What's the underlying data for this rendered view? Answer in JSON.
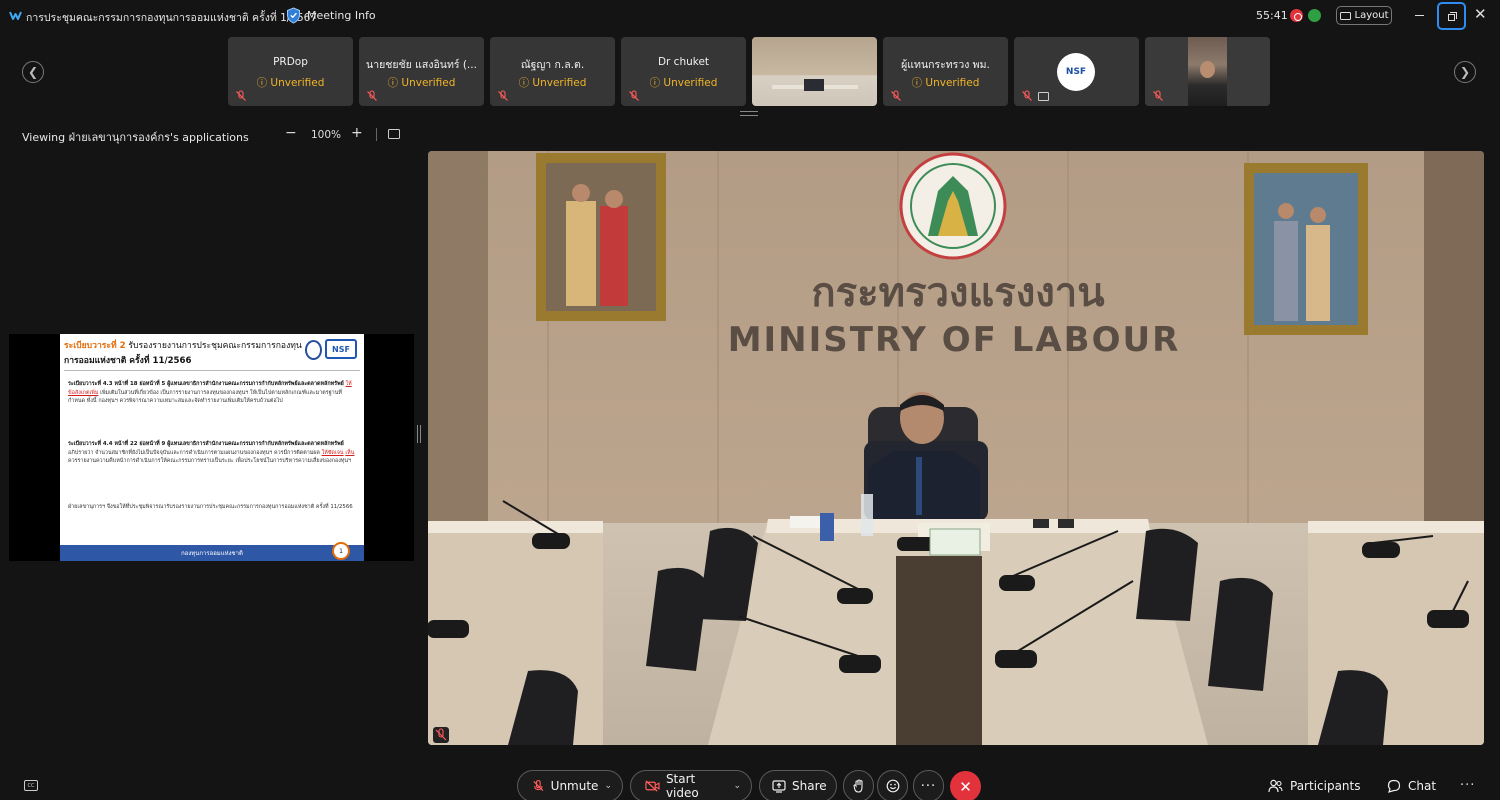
{
  "window": {
    "title": "การประชุมคณะกรรมการกองทุนการออมแห่งชาติ ครั้งที่ 1/2567",
    "meeting_info": "Meeting Info",
    "timer": "55:41",
    "layout_label": "Layout",
    "close_glyph": "✕"
  },
  "participants": [
    {
      "name": "PRDop",
      "status": "Unverified"
    },
    {
      "name": "นายชยชัย แสงอินทร์ (...",
      "status": "Unverified"
    },
    {
      "name": "ณัฐญา  ก.ล.ต.",
      "status": "Unverified"
    },
    {
      "name": "Dr chuket",
      "status": "Unverified"
    },
    {
      "name": "",
      "status": ""
    },
    {
      "name": "ผู้แทนกระทรวง พม.",
      "status": "Unverified"
    },
    {
      "name": "",
      "status": ""
    },
    {
      "name": "",
      "status": ""
    }
  ],
  "participant_logo_text": "NSF",
  "share_bar": {
    "viewing": "Viewing ฝ่ายเลขานุการองค์กร's applications",
    "zoom": "100%",
    "minus": "−",
    "plus": "+"
  },
  "slide": {
    "agenda_label": "ระเบียบวาระที่ 2",
    "heading_line1": "รับรองรายงานการประชุมคณะกรรมการกองทุน",
    "heading_line2": "การออมแห่งชาติ ครั้งที่ 11/2566",
    "logo_text": "NSF",
    "para1_kw": "ระเบียบวาระที่ 4.3 หน้าที่ 18 ย่อหน้าที่ 5 ผู้แทนเลขาธิการสำนักงานคณะกรรมการกำกับหลักทรัพย์และตลาดหลักทรัพย์",
    "para1_red": "ให้ข้อสังเกตเพิ่ม",
    "para1_rest": "เพิ่มเติมในส่วนที่เกี่ยวข้อง เป็นการรายงานการลงทุนของกองทุนฯ ให้เป็นไปตามหลักเกณฑ์และมาตรฐานที่กำหนด ทั้งนี้ กองทุนฯ ควรพิจารณาความเหมาะสมและจัดทำรายงานเพิ่มเติมให้ครบถ้วนต่อไป",
    "para2_kw": "ระเบียบวาระที่ 4.4 หน้าที่ 22 ย่อหน้าที่ 9 ผู้แทนเลขาธิการสำนักงานคณะกรรมการกำกับหลักทรัพย์และตลาดหลักทรัพย์",
    "para2_mid": "อภิปรายว่า จำนวนสมาชิกที่ยังไม่เป็นปัจจุบันและการดำเนินการตามแผนงานของกองทุนฯ ควรมีการติดตามผล",
    "para2_red": "ให้ชัดเจน",
    "para2_red2": "เห็น",
    "para2_rest": "ควรรายงานความคืบหน้าการดำเนินการให้คณะกรรมการทราบเป็นระยะ เพื่อประโยชน์ในการบริหารความเสี่ยงของกองทุนฯ",
    "para3": "ฝ่ายเลขานุการฯ จึงขอให้ที่ประชุมพิจารณารับรองรายงานการประชุมคณะกรรมการกองทุนการออมแห่งชาติ ครั้งที่ 11/2566",
    "footer": "กองทุนการออมแห่งชาติ",
    "page_number": "1"
  },
  "video": {
    "wall_text_th": "กระทรวงแรงงาน",
    "wall_text_en": "MINISTRY OF LABOUR"
  },
  "toolbar": {
    "cc": "CC",
    "unmute": "Unmute",
    "start_video": "Start video",
    "share": "Share",
    "more": "···",
    "participants": "Participants",
    "chat": "Chat",
    "more_right": "···",
    "leave_glyph": "✕"
  },
  "colors": {
    "accent_blue": "#2f8cf0",
    "leave_red": "#e2333d",
    "unverified": "#f0b429",
    "slide_orange": "#e46c0a"
  }
}
